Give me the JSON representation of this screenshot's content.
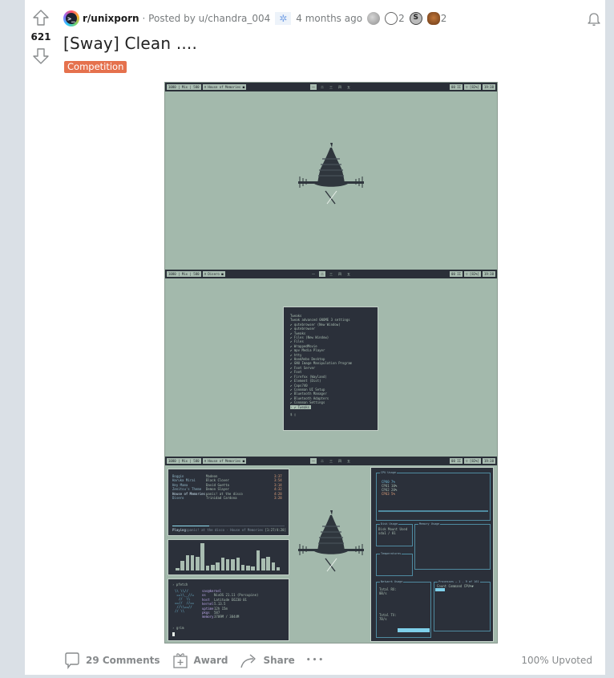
{
  "post": {
    "votes": "621",
    "subreddit": "r/unixporn",
    "posted_by_prefix": "· Posted by",
    "author": "u/chandra_004",
    "time_ago": "4 months ago",
    "title": "[Sway] Clean ....",
    "flair": "Competition",
    "flair_color": "#e5714d",
    "awards": [
      {
        "icon": "silver-award-icon",
        "count": ""
      },
      {
        "icon": "wholesome-award-icon",
        "count": "2"
      },
      {
        "icon": "s-coin-award-icon",
        "count": ""
      },
      {
        "icon": "bear-award-icon",
        "count": "2"
      }
    ]
  },
  "actions": {
    "comments": "29 Comments",
    "award": "Award",
    "share": "Share",
    "more": "•••",
    "upvoted": "100% Upvoted"
  },
  "media": {
    "workspaces": [
      {
        "bar_left": [
          "1080 | Mix | 580",
          "♬ House of Memories ■"
        ],
        "bar_center": [
          "一",
          "二",
          "三",
          "四",
          "五"
        ],
        "active_ws": 0,
        "bar_right": [
          "00 II",
          "▽                  [82%]",
          "19:38"
        ]
      },
      {
        "bar_left": [
          "1080 | Mix | 580",
          "♬ Disero ■"
        ],
        "bar_center": [
          "一",
          "二",
          "三",
          "四",
          "五"
        ],
        "active_ws": 1,
        "bar_right": [
          "00 II",
          "▽                  [82%]",
          "19:38"
        ]
      },
      {
        "bar_left": [
          "1080 | Mix | 580",
          "♬ House of Memories ■"
        ],
        "bar_center": [
          "一",
          "二",
          "三",
          "四",
          "五"
        ],
        "active_ws": 0,
        "bar_right": [
          "00 II",
          "▽                  [82%]",
          "19:38"
        ]
      }
    ],
    "launcher": {
      "header": "Tweaks",
      "subheader": "Tweak advanced GNOME 3 settings",
      "items": [
        "qutebrowser (New Window)",
        "qutebrowser",
        "Tweaks",
        "Files (New Window)",
        "Files",
        "WrappedMovie",
        "mpv Media Player",
        "htty",
        "HandAnbo Desktop",
        "GNU Image Manipulation Program",
        "Foot Server",
        "Foot",
        "Firefox (Wayland)",
        "Element (Dist)",
        "Caps740",
        "Connman UI Setup",
        "Bluetooth Manager",
        "Bluetooth Adapters",
        "Connman Settings"
      ],
      "selected": "Tweaks",
      "prompt": "$ ▯"
    },
    "music": {
      "tracks": [
        {
          "title": "Boggin",
          "artist": "Madeon",
          "time": "3:37"
        },
        {
          "title": "Haruka Mirai",
          "artist": "Black Clover",
          "time": "3:54"
        },
        {
          "title": "Hey Mama",
          "artist": "David Guetta",
          "time": "3:14"
        },
        {
          "title": "Zenitsu's Theme",
          "artist": "Demon Slayer",
          "time": "4:32"
        },
        {
          "title": "House of Memories",
          "artist": "panic! at the disco",
          "time": "4:28"
        },
        {
          "title": "Disero",
          "artist": "Trinidad Cardona",
          "time": "3:28"
        }
      ],
      "now_playing_label": "Playing:",
      "now_playing": "panic! at the disco · House of Memories",
      "position": "[1:27/4:28]",
      "progress": 0.33
    },
    "visualizer_levels": [
      0.1,
      0.35,
      0.55,
      0.55,
      0.5,
      1.0,
      0.18,
      0.2,
      0.3,
      0.48,
      0.4,
      0.42,
      0.48,
      0.2,
      0.18,
      0.15,
      0.75,
      0.45,
      0.5,
      0.3,
      0.12
    ],
    "fetch": {
      "cmd": "› pfetch",
      "user": "sas@kernel",
      "rows": [
        {
          "k": "os",
          "v": "NixOS 21.11 (Porcupine)"
        },
        {
          "k": "host",
          "v": "Latitude E6230 01"
        },
        {
          "k": "kernel",
          "v": "5.13.5"
        },
        {
          "k": "uptime",
          "v": "12h 15m"
        },
        {
          "k": "pkgs",
          "v": "587"
        },
        {
          "k": "memory",
          "v": "3709M / 3844M"
        }
      ],
      "cmd2": "› grim"
    },
    "btm": {
      "cpu_title": "CPU Usage",
      "cpus": [
        {
          "name": "CPU0",
          "val": "7%"
        },
        {
          "name": "CPU1",
          "val": "10%"
        },
        {
          "name": "CPU2",
          "val": "20%"
        },
        {
          "name": "CPU3",
          "val": "5%"
        }
      ],
      "disk_title": "Disk Usage",
      "disk_headers": [
        "Disk",
        "Mount",
        "Used"
      ],
      "disk_row": [
        "sda1",
        "/",
        "81"
      ],
      "memory_title": "Memory Usage",
      "temp_title": "Temperatures",
      "net_title": "Network Usage",
      "rx_label": "Total RX:",
      "rx_val": "0B/s",
      "tx_label": "Total TX:",
      "tx_val": "7B/s",
      "proc_title": "Processes",
      "proc_range": "1 - 9 of 161",
      "proc_headers": [
        "Count",
        "Command",
        "CPU%▼"
      ]
    }
  }
}
